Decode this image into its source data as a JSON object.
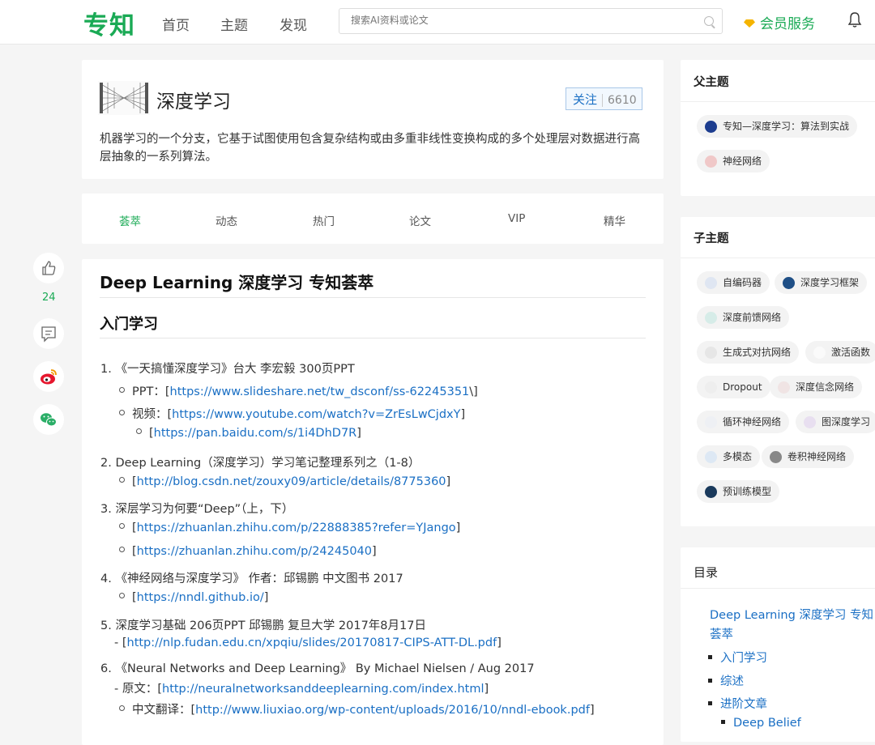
{
  "header": {
    "logo": "专知",
    "nav": [
      "首页",
      "主题",
      "发现"
    ],
    "search_placeholder": "搜索AI资料或论文",
    "vip_label": "会员服务"
  },
  "topic": {
    "title": "深度学习",
    "follow_label": "关注",
    "follow_count": "6610",
    "description": "机器学习的一个分支，它基于试图使用包含复杂结构或由多重非线性变换构成的多个处理层对数据进行高层抽象的一系列算法。"
  },
  "tabs": [
    "荟萃",
    "动态",
    "热门",
    "论文",
    "VIP",
    "精华"
  ],
  "social": {
    "like_count": "24"
  },
  "article": {
    "title": "Deep Learning 深度学习 专知荟萃",
    "section": "入门学习",
    "lines": [
      "1. 《一天搞懂深度学习》台大 李宏毅 300页PPT",
      "PPT：[",
      "https://www.slideshare.net/tw_dsconf/ss-62245351",
      "\\]",
      "视频：[",
      "https://www.youtube.com/watch?v=ZrEsLwCjdxY",
      "]",
      "[",
      "https://pan.baidu.com/s/1i4DhD7R",
      "]",
      "2. Deep Learning（深度学习）学习笔记整理系列之（1-8）",
      "[",
      "http://blog.csdn.net/zouxy09/article/details/8775360",
      "]",
      "3. 深层学习为何要“Deep”（上，下）",
      "[",
      "https://zhuanlan.zhihu.com/p/22888385?refer=YJango",
      "]",
      "[",
      "https://zhuanlan.zhihu.com/p/24245040",
      "]",
      "4. 《神经网络与深度学习》 作者：邱锡鹏 中文图书 2017",
      "[",
      "https://nndl.github.io/",
      "]",
      "5. 深度学习基础 206页PPT 邱锡鹏 复旦大学 2017年8月17日",
      "- [",
      "http://nlp.fudan.edu.cn/xpqiu/slides/20170817-CIPS-ATT-DL.pdf",
      "]",
      "6. 《Neural Networks and Deep Learning》 By Michael Nielsen / Aug 2017",
      "- 原文：[",
      "http://neuralnetworksanddeeplearning.com/index.html",
      "]",
      "中文翻译：[",
      "http://www.liuxiao.org/wp-content/uploads/2016/10/nndl-ebook.pdf",
      "]"
    ]
  },
  "sidebar": {
    "parent_title": "父主题",
    "parent_topics": [
      "专知—深度学习：算法到实战",
      "神经网络"
    ],
    "child_title": "子主题",
    "child_topics": [
      "自编码器",
      "深度学习框架",
      "深度前馈网络",
      "生成式对抗网络",
      "激活函数",
      "Dropout",
      "深度信念网络",
      "循环神经网络",
      "图深度学习",
      "多模态",
      "卷积神经网络",
      "预训练模型"
    ],
    "toc_title": "目录",
    "toc": [
      "Deep Learning 深度学习 专知",
      "荟萃",
      "入门学习",
      "综述",
      "进阶文章",
      "Deep Belief"
    ]
  },
  "colors": {
    "brand_green": "#1aaa55",
    "link_blue": "#1a6fc4",
    "vip_gold": "#f5b400"
  }
}
